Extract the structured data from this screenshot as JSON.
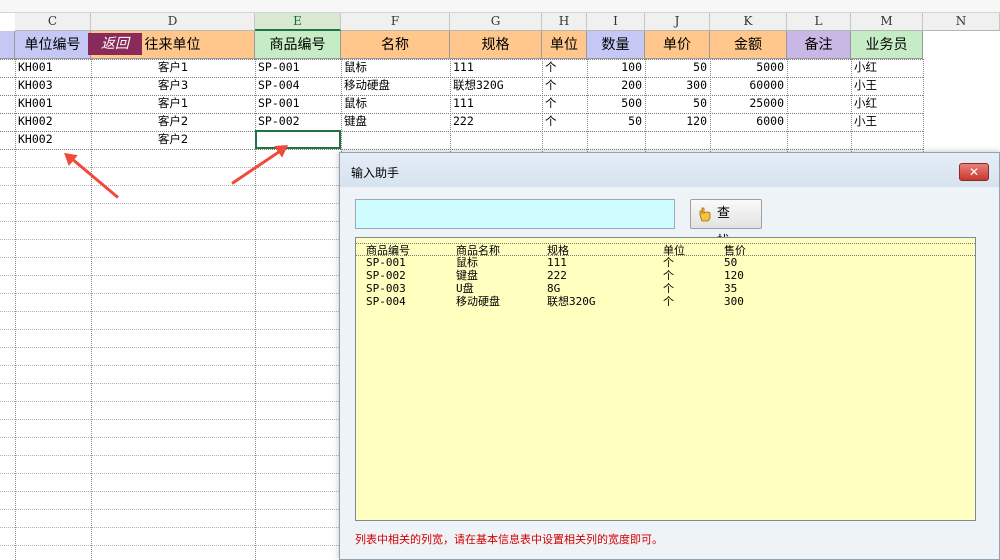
{
  "sheet": {
    "column_letters": [
      "C",
      "D",
      "E",
      "F",
      "G",
      "H",
      "I",
      "J",
      "K",
      "L",
      "M",
      "N"
    ],
    "header_labels": [
      "单位编号",
      "往来单位",
      "商品编号",
      "名称",
      "规格",
      "单位",
      "数量",
      "单价",
      "金额",
      "备注",
      "业务员"
    ],
    "return_button": "返回",
    "rows": [
      {
        "c": "KH001",
        "d": "客户1",
        "e": "SP-001",
        "f": "鼠标",
        "g": "111",
        "h": "个",
        "i": "100",
        "j": "50",
        "k": "5000",
        "l": "",
        "m": "小红"
      },
      {
        "c": "KH003",
        "d": "客户3",
        "e": "SP-004",
        "f": "移动硬盘",
        "g": "联想320G",
        "h": "个",
        "i": "200",
        "j": "300",
        "k": "60000",
        "l": "",
        "m": "小王"
      },
      {
        "c": "KH001",
        "d": "客户1",
        "e": "SP-001",
        "f": "鼠标",
        "g": "111",
        "h": "个",
        "i": "500",
        "j": "50",
        "k": "25000",
        "l": "",
        "m": "小红"
      },
      {
        "c": "KH002",
        "d": "客户2",
        "e": "SP-002",
        "f": "键盘",
        "g": "222",
        "h": "个",
        "i": "50",
        "j": "120",
        "k": "6000",
        "l": "",
        "m": "小王"
      },
      {
        "c": "KH002",
        "d": "客户2",
        "e": "",
        "f": "",
        "g": "",
        "h": "",
        "i": "",
        "j": "",
        "k": "",
        "l": "",
        "m": ""
      }
    ]
  },
  "dialog": {
    "title": "输入助手",
    "close_glyph": "✕",
    "search_value": "",
    "search_button": "查 找",
    "columns": [
      "商品编号",
      "商品名称",
      "规格",
      "单位",
      "售价"
    ],
    "items": [
      {
        "code": "SP-001",
        "name": "鼠标",
        "spec": "111",
        "unit": "个",
        "price": "50"
      },
      {
        "code": "SP-002",
        "name": "键盘",
        "spec": "222",
        "unit": "个",
        "price": "120"
      },
      {
        "code": "SP-003",
        "name": "U盘",
        "spec": "8G",
        "unit": "个",
        "price": "35"
      },
      {
        "code": "SP-004",
        "name": "移动硬盘",
        "spec": "联想320G",
        "unit": "个",
        "price": "300"
      }
    ],
    "footer_note": "列表中相关的列宽，请在基本信息表中设置相关列的宽度即可。"
  },
  "colors": {
    "header_blue": "#c5c8f5",
    "header_orange": "#ffc78c",
    "header_green": "#c5ecc5",
    "header_purple": "#c9b8e6",
    "arrow_red": "#f04a3a",
    "list_background": "#ffffc0",
    "search_background": "#cffcff"
  },
  "icons": {
    "search": "hand-pointer-icon",
    "close": "close-icon"
  }
}
